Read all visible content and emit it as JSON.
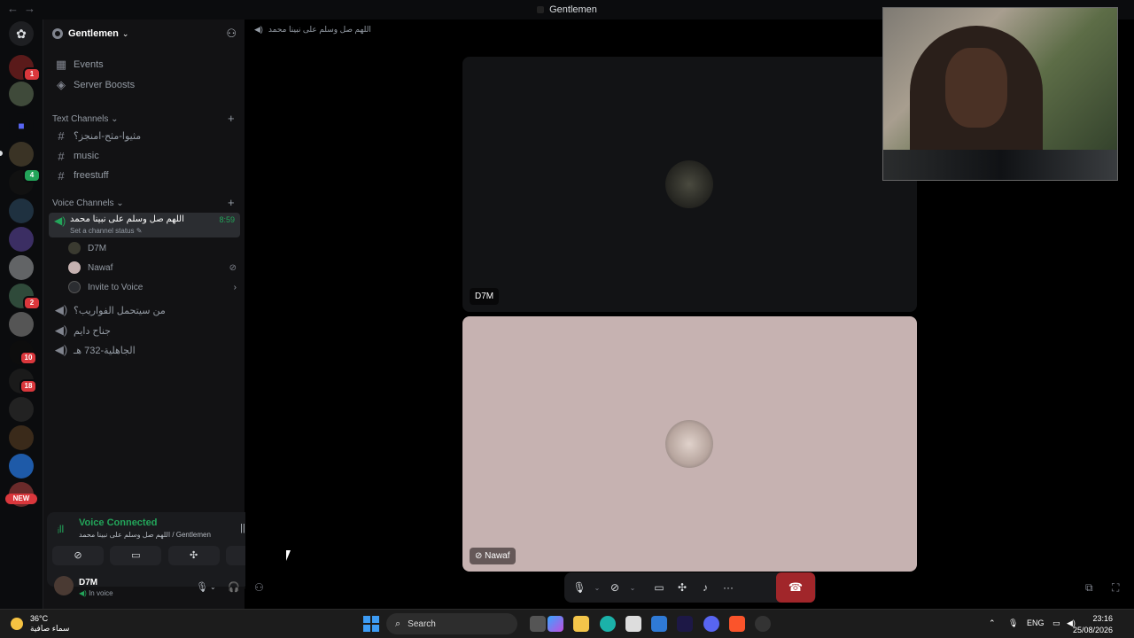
{
  "window": {
    "title": "Gentlemen"
  },
  "guilds": {
    "badges": [
      "1",
      "4",
      "2",
      "10",
      "18"
    ],
    "new_label": "NEW"
  },
  "server": {
    "name": "Gentlemen",
    "items": [
      {
        "label": "Events",
        "icon": "calendar-icon"
      },
      {
        "label": "Server Boosts",
        "icon": "boost-icon"
      }
    ],
    "text_category": "Text Channels",
    "text_channels": [
      "مثيوا-مثح-امنجز؟",
      "music",
      "freestuff"
    ],
    "voice_category": "Voice Channels",
    "active_voice": {
      "name": "اللهم صل وسلم على نبينا محمد",
      "timer": "8:59",
      "status": "Set a channel status"
    },
    "voice_users": [
      "D7M",
      "Nawaf"
    ],
    "invite_label": "Invite to Voice",
    "other_voice": [
      "من سيتحمل الفواريب؟",
      "جناح دايم",
      "الجاهلية-732 هـ"
    ]
  },
  "voice_panel": {
    "title": "Voice Connected",
    "subtitle": "اللهم صل وسلم على نبينا محمد / Gentlemen"
  },
  "user": {
    "name": "D7M",
    "status": "In voice"
  },
  "main": {
    "header": "اللهم صل وسلم على نبينا محمد",
    "tiles": [
      {
        "name": "D7M"
      },
      {
        "name": "Nawaf"
      }
    ]
  },
  "taskbar": {
    "weather_temp": "36°C",
    "weather_desc": "سماء صافية",
    "search": "Search",
    "lang": "ENG",
    "time": "23:16",
    "date": "25/08/2026"
  },
  "colors": {
    "accent_green": "#23a55a",
    "hangup_red": "#a1262a",
    "sidebar_bg": "#121214"
  }
}
